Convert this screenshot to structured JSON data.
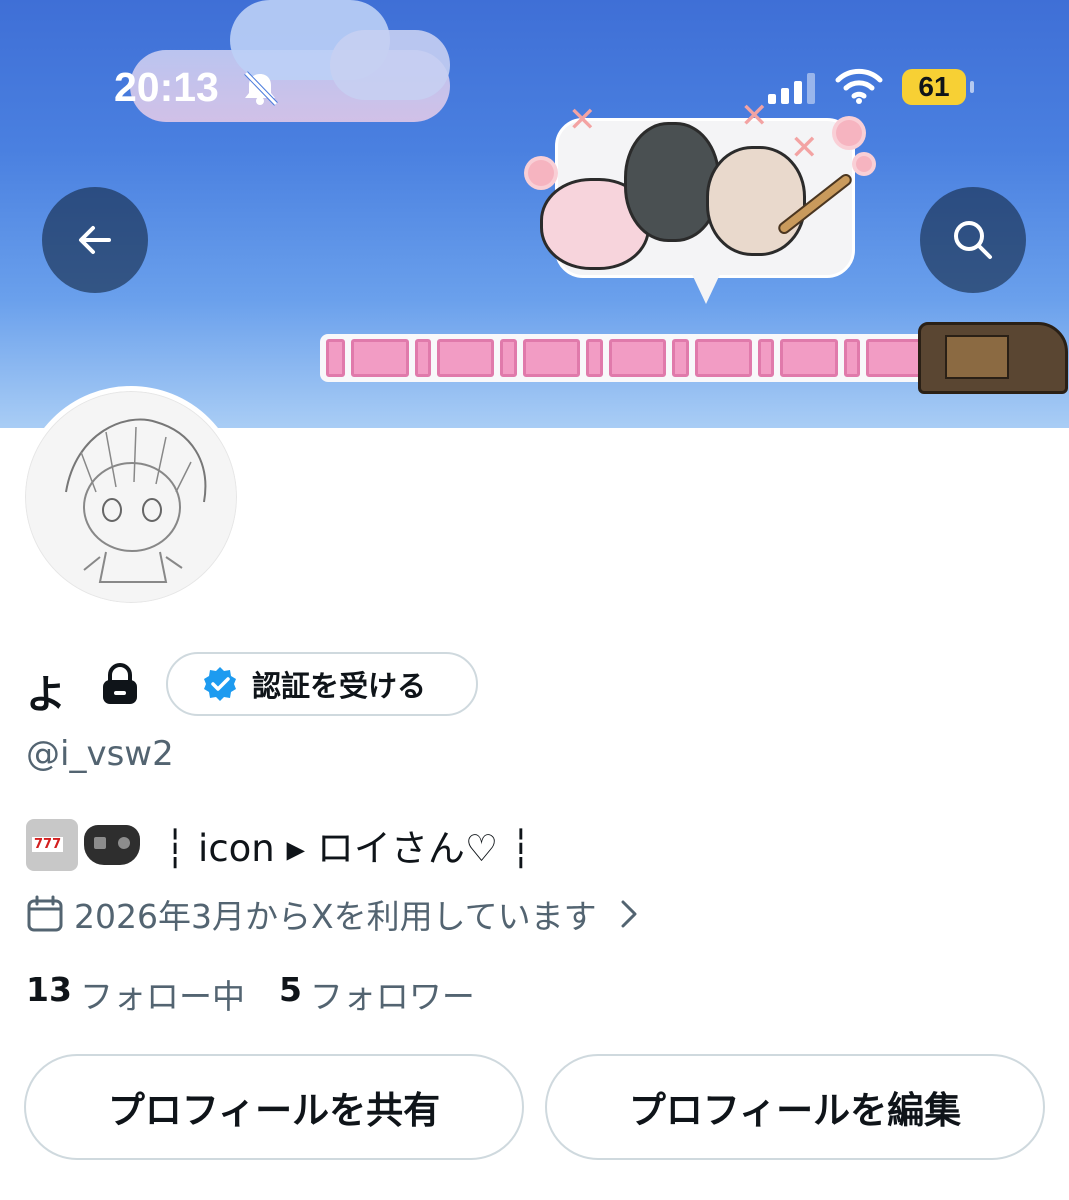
{
  "status_bar": {
    "time": "20:13",
    "battery": "61"
  },
  "profile": {
    "display_name": "よ",
    "verify_label": "認証を受ける",
    "handle": "@i_vsw2",
    "bio_text": "┆ icon ▸ ロイさん♡ ┆",
    "joined": "2026年3月からXを利用しています",
    "following_count": "13",
    "following_label": "フォロー中",
    "followers_count": "5",
    "followers_label": "フォロワー"
  },
  "actions": {
    "share_label": "プロフィールを共有",
    "edit_label": "プロフィールを編集"
  },
  "icons": {
    "back": "arrow-left-icon",
    "search": "search-icon",
    "lock": "lock-icon",
    "verify": "verified-badge-icon",
    "calendar": "calendar-icon",
    "chevron": "chevron-right-icon",
    "bell": "bell-off-icon"
  },
  "colors": {
    "accent": "#1d9bf0",
    "secondary_text": "#536471",
    "battery": "#f7d034"
  }
}
